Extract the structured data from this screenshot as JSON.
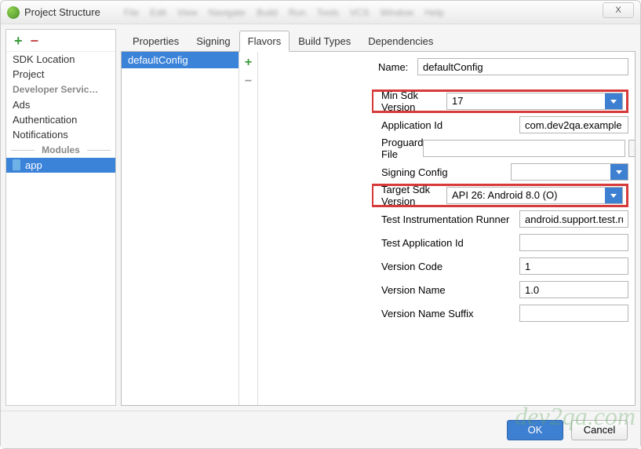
{
  "window": {
    "title": "Project Structure",
    "close_x": "X"
  },
  "sidebar": {
    "items": [
      "SDK Location",
      "Project"
    ],
    "section_dev": "Developer Servic…",
    "dev_items": [
      "Ads",
      "Authentication",
      "Notifications"
    ],
    "section_modules": "Modules",
    "modules": [
      "app"
    ]
  },
  "tabs": {
    "items": [
      "Properties",
      "Signing",
      "Flavors",
      "Build Types",
      "Dependencies"
    ],
    "active_index": 2
  },
  "flavors": {
    "list": [
      "defaultConfig"
    ],
    "selected_index": 0
  },
  "form": {
    "name_label": "Name:",
    "name_value": "defaultConfig",
    "rows": {
      "min_sdk_label": "Min Sdk Version",
      "min_sdk_value": "17",
      "app_id_label": "Application Id",
      "app_id_value": "com.dev2qa.example",
      "proguard_label": "Proguard File",
      "proguard_value": "",
      "signing_label": "Signing Config",
      "signing_value": "",
      "target_sdk_label": "Target Sdk Version",
      "target_sdk_value": "API 26: Android 8.0 (O)",
      "test_runner_label": "Test Instrumentation Runner",
      "test_runner_value": "android.support.test.runner.AndroidJUnitRunner",
      "test_app_id_label": "Test Application Id",
      "test_app_id_value": "",
      "version_code_label": "Version Code",
      "version_code_value": "1",
      "version_name_label": "Version Name",
      "version_name_value": "1.0",
      "version_suffix_label": "Version Name Suffix",
      "version_suffix_value": ""
    }
  },
  "footer": {
    "ok": "OK",
    "cancel": "Cancel"
  },
  "watermark": "dev2qa.com"
}
